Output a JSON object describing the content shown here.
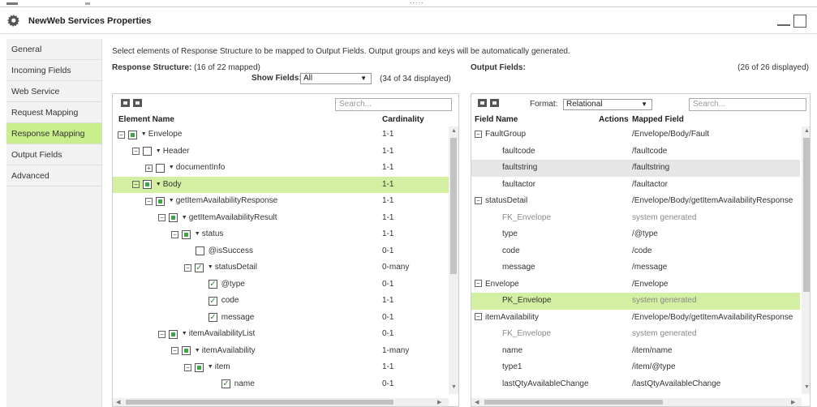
{
  "window": {
    "title": "NewWeb Services Properties",
    "top_dots": "....."
  },
  "sidebar": {
    "items": [
      {
        "label": "General",
        "active": false
      },
      {
        "label": "Incoming Fields",
        "active": false
      },
      {
        "label": "Web Service",
        "active": false
      },
      {
        "label": "Request Mapping",
        "active": false
      },
      {
        "label": "Response Mapping",
        "active": true
      },
      {
        "label": "Output Fields",
        "active": false
      },
      {
        "label": "Advanced",
        "active": false
      }
    ]
  },
  "instructions": "Select elements of Response Structure to be mapped to Output Fields. Output groups and keys will be automatically generated.",
  "response_structure": {
    "label": "Response Structure:",
    "mapped": "(16 of 22 mapped)",
    "show_fields_label": "Show Fields:",
    "show_fields_value": "All",
    "displayed": "(34 of 34 displayed)",
    "search_placeholder": "Search...",
    "col_element": "Element Name",
    "col_cardinality": "Cardinality",
    "rows": [
      {
        "name": "Envelope",
        "card": "1-1"
      },
      {
        "name": "Header",
        "card": "1-1"
      },
      {
        "name": "documentInfo",
        "card": "1-1"
      },
      {
        "name": "Body",
        "card": "1-1"
      },
      {
        "name": "getItemAvailabilityResponse",
        "card": "1-1"
      },
      {
        "name": "getItemAvailabilityResult",
        "card": "1-1"
      },
      {
        "name": "status",
        "card": "1-1"
      },
      {
        "name": "@isSuccess",
        "card": "0-1"
      },
      {
        "name": "statusDetail",
        "card": "0-many"
      },
      {
        "name": "@type",
        "card": "0-1"
      },
      {
        "name": "code",
        "card": "1-1"
      },
      {
        "name": "message",
        "card": "0-1"
      },
      {
        "name": "itemAvailabilityList",
        "card": "0-1"
      },
      {
        "name": "itemAvailability",
        "card": "1-many"
      },
      {
        "name": "item",
        "card": "1-1"
      },
      {
        "name": "name",
        "card": "0-1"
      }
    ]
  },
  "output_fields": {
    "label": "Output Fields:",
    "displayed": "(26 of 26 displayed)",
    "format_label": "Format:",
    "format_value": "Relational",
    "search_placeholder": "Search...",
    "col_field": "Field Name",
    "col_actions": "Actions",
    "col_mapped": "Mapped Field",
    "rows": [
      {
        "field": "FaultGroup",
        "mapped": "/Envelope/Body/Fault"
      },
      {
        "field": "faultcode",
        "mapped": "/faultcode"
      },
      {
        "field": "faultstring",
        "mapped": "/faultstring"
      },
      {
        "field": "faultactor",
        "mapped": "/faultactor"
      },
      {
        "field": "statusDetail",
        "mapped": "/Envelope/Body/getItemAvailabilityResponse"
      },
      {
        "field": "FK_Envelope",
        "mapped": "system generated"
      },
      {
        "field": "type",
        "mapped": "/@type"
      },
      {
        "field": "code",
        "mapped": "/code"
      },
      {
        "field": "message",
        "mapped": "/message"
      },
      {
        "field": "Envelope",
        "mapped": "/Envelope"
      },
      {
        "field": "PK_Envelope",
        "mapped": "system generated"
      },
      {
        "field": "itemAvailability",
        "mapped": "/Envelope/Body/getItemAvailabilityResponse"
      },
      {
        "field": "FK_Envelope",
        "mapped": "system generated"
      },
      {
        "field": "name",
        "mapped": "/item/name"
      },
      {
        "field": "type1",
        "mapped": "/item/@type"
      },
      {
        "field": "lastQtyAvailableChange",
        "mapped": "/lastQtyAvailableChange"
      }
    ]
  },
  "colors": {
    "highlight": "#d3f0a2",
    "active_tab": "#c9ef8c",
    "check_green": "#3aa845"
  }
}
